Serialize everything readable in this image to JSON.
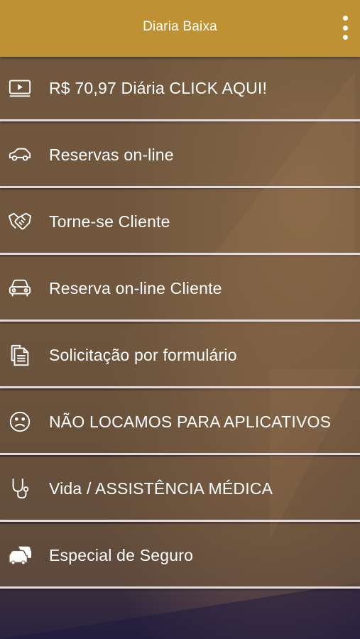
{
  "app_bar": {
    "title": "Diaria Baixa",
    "overflow_icon": "more-vertical-icon"
  },
  "menu": {
    "items": [
      {
        "label": "R$ 70,97 Diária CLICK AQUI!",
        "icon": "video-play-icon"
      },
      {
        "label": "Reservas on-line",
        "icon": "car-outline-icon"
      },
      {
        "label": "Torne-se Cliente",
        "icon": "handshake-icon"
      },
      {
        "label": "Reserva on-line Cliente",
        "icon": "car-front-icon"
      },
      {
        "label": "Solicitação por formulário",
        "icon": "documents-icon"
      },
      {
        "label": "NÃO LOCAMOS PARA APLICATIVOS",
        "icon": "sad-face-icon"
      },
      {
        "label": "Vida / ASSISTÊNCIA MÉDICA",
        "icon": "stethoscope-icon"
      },
      {
        "label": "Especial de Seguro",
        "icon": "car-crash-icon"
      }
    ]
  },
  "colors": {
    "app_bar": "#be9133",
    "item_background": "#73583c",
    "divider": "#ebe1e1",
    "text": "#ffffff"
  }
}
